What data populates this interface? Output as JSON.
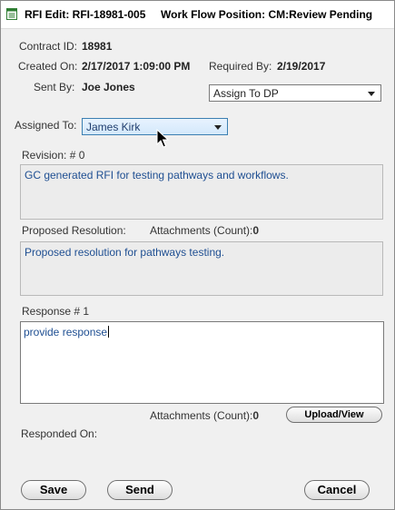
{
  "window": {
    "title": "RFI Edit: RFI-18981-005",
    "workflow": "Work Flow Position: CM:Review Pending"
  },
  "contract": {
    "label": "Contract ID:",
    "value": "18981"
  },
  "created": {
    "label": "Created On:",
    "value": "2/17/2017 1:09:00 PM"
  },
  "required": {
    "label": "Required By:",
    "value": "2/19/2017"
  },
  "sent": {
    "label": "Sent By:",
    "value": "Joe Jones"
  },
  "action_select": {
    "value": "Assign To DP"
  },
  "assigned": {
    "label": "Assigned To:",
    "value": "James Kirk"
  },
  "revision": {
    "label": "Revision: # 0",
    "text": "GC generated RFI for testing pathways and workflows."
  },
  "proposed": {
    "label": "Proposed Resolution:",
    "attachments_label": "Attachments (Count):",
    "attachments_count": "0",
    "text": "Proposed resolution for pathways testing."
  },
  "response": {
    "label": "Response # 1",
    "text": "provide response",
    "attachments_label": "Attachments (Count):",
    "attachments_count": "0",
    "upload_label": "Upload/View"
  },
  "responded_on": {
    "label": "Responded On:"
  },
  "buttons": {
    "save": "Save",
    "send": "Send",
    "cancel": "Cancel"
  },
  "icons": {
    "window": "document-icon",
    "cursor": "mouse-pointer-icon"
  }
}
